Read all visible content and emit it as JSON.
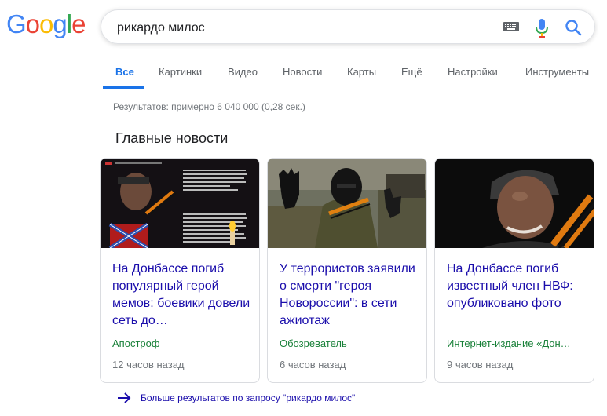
{
  "logo": {
    "letters": [
      "G",
      "o",
      "o",
      "g",
      "l",
      "e"
    ]
  },
  "search": {
    "query": "рикардо милос"
  },
  "icons": {
    "keyboard": "keyboard-icon",
    "mic": "mic-icon",
    "search": "search-icon",
    "arrow": "arrow-right-icon"
  },
  "tabs": [
    {
      "label": "Все",
      "active": true
    },
    {
      "label": "Картинки"
    },
    {
      "label": "Видео"
    },
    {
      "label": "Новости"
    },
    {
      "label": "Карты"
    },
    {
      "label": "Ещё"
    },
    {
      "label": "Настройки"
    },
    {
      "label": "Инструменты"
    }
  ],
  "result_stats": "Результатов: примерно 6 040 000 (0,28 сек.)",
  "section_title": "Главные новости",
  "cards": [
    {
      "title": "На Донбассе погиб популярный герой мемов: боевики довели сеть до…",
      "source": "Апостроф",
      "time": "12 часов назад"
    },
    {
      "title": "У террористов заявили о смерти \"героя Новороссии\": в сети ажиотаж",
      "source": "Обозреватель",
      "time": "6 часов назад"
    },
    {
      "title": "На Донбассе погиб известный член НВФ: опубликовано фото",
      "source": "Интернет-издание «Дон…",
      "time": "9 часов назад"
    }
  ],
  "more_results": "Больше результатов по запросу \"рикардо милос\"",
  "colors": {
    "link": "#1a0dab",
    "accent": "#1a73e8",
    "source": "#188038",
    "muted": "#70757a"
  }
}
